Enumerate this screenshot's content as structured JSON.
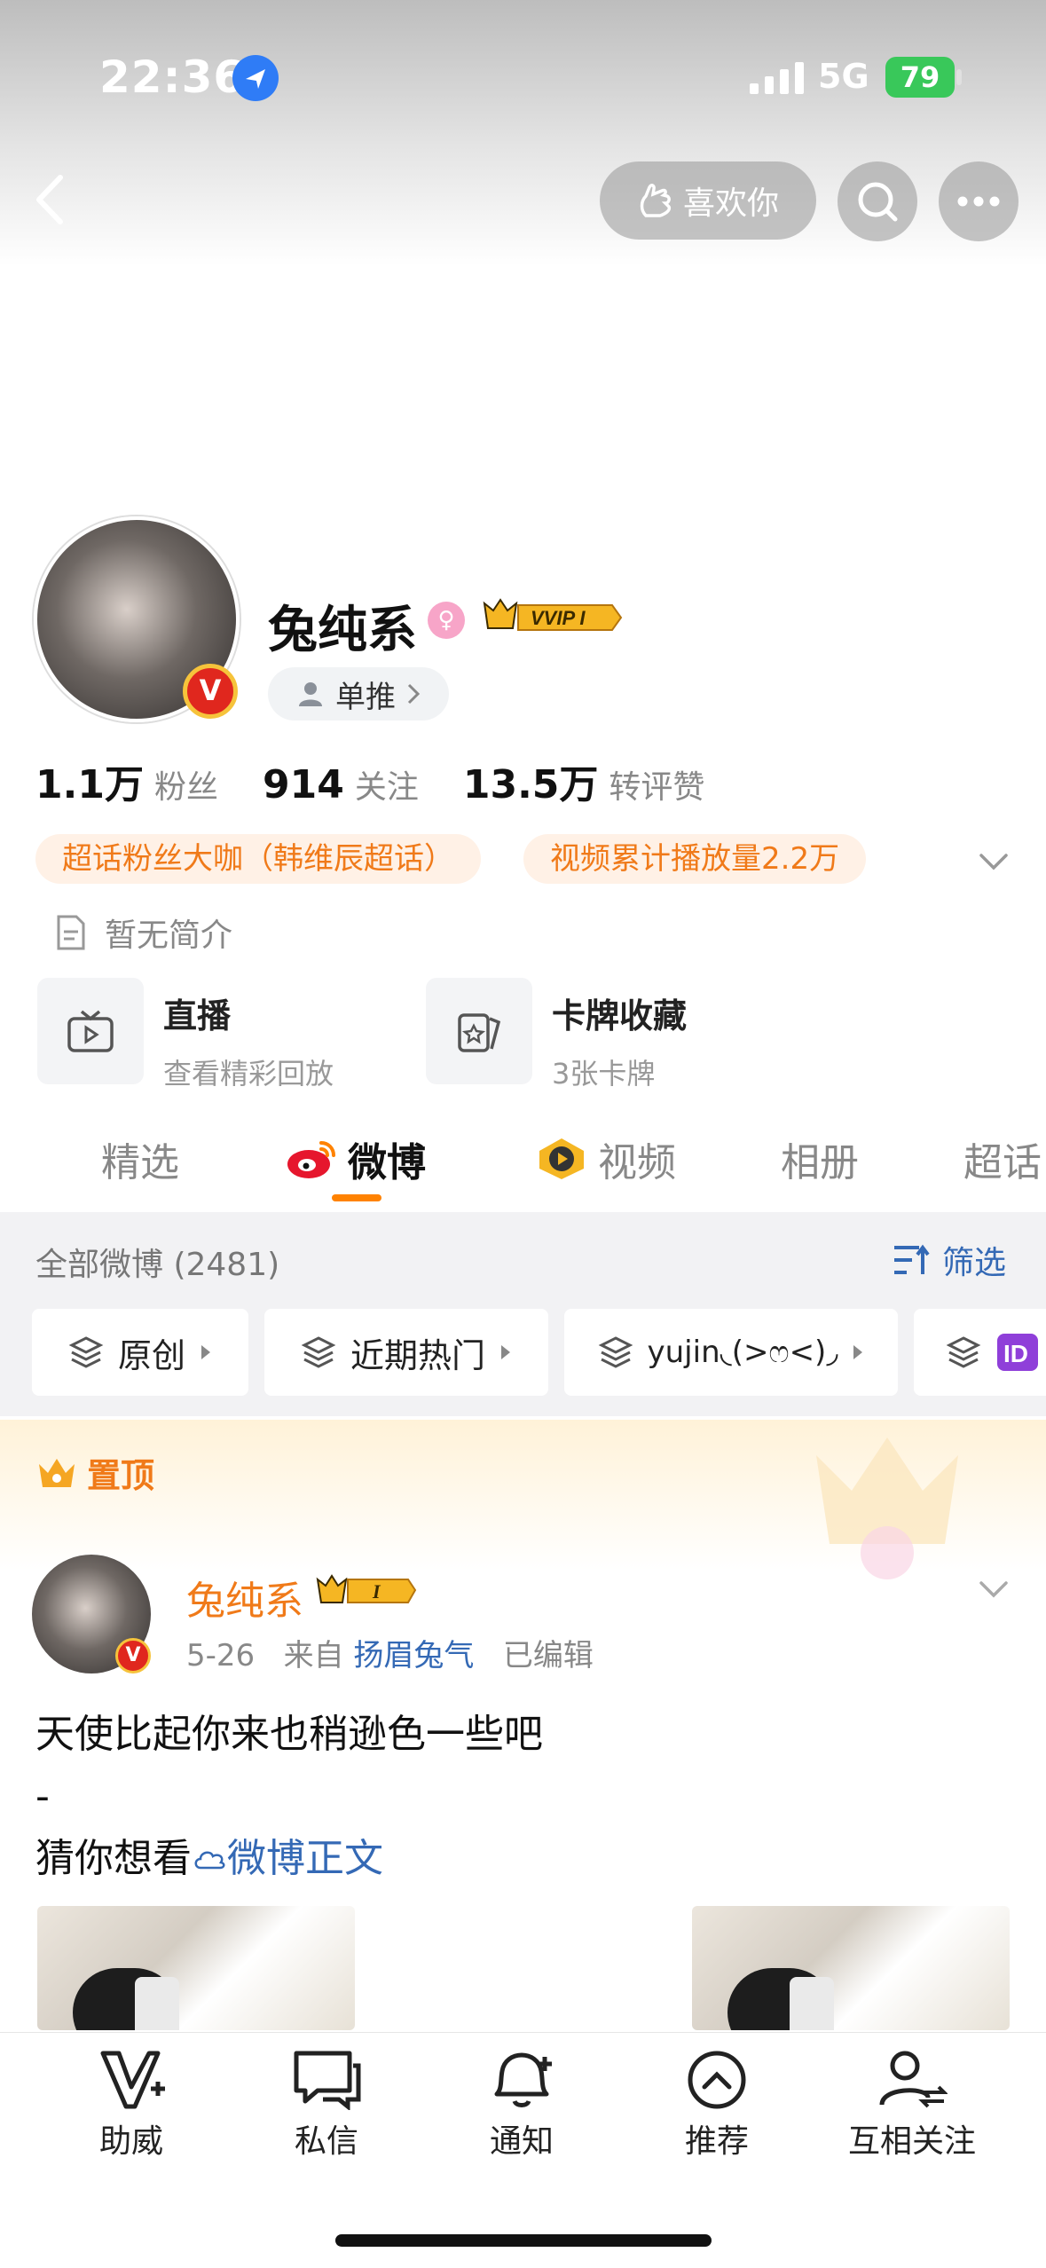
{
  "status_bar": {
    "time": "22:36",
    "network": "5G",
    "battery": "79"
  },
  "nav": {
    "like_label": "喜欢你"
  },
  "profile": {
    "name": "兔纯系",
    "vvip_label": "VVIP I",
    "tag_label": "单推",
    "stats": [
      {
        "value": "1.1万",
        "label": "粉丝"
      },
      {
        "value": "914",
        "label": "关注"
      },
      {
        "value": "13.5万",
        "label": "转评赞"
      }
    ],
    "chips": [
      "超话粉丝大咖（韩维辰超话）",
      "视频累计播放量2.2万"
    ],
    "bio": "暂无简介",
    "features": [
      {
        "title": "直播",
        "sub": "查看精彩回放",
        "icon": "tv-icon"
      },
      {
        "title": "卡牌收藏",
        "sub": "3张卡牌",
        "icon": "card-icon"
      }
    ]
  },
  "tabs": [
    {
      "label": "精选",
      "active": false
    },
    {
      "label": "微博",
      "active": true
    },
    {
      "label": "视频",
      "active": false
    },
    {
      "label": "相册",
      "active": false
    },
    {
      "label": "超话",
      "active": false
    }
  ],
  "feed": {
    "all_count": "全部微博 (2481)",
    "filter_label": "筛选",
    "filter_tags": [
      "原创",
      "近期热门",
      "yujin◟(>ෆ<)◞"
    ],
    "pinned_label": "置顶"
  },
  "post": {
    "author": "兔纯系",
    "vip_label": "I",
    "date": "5-26",
    "source_prefix": "来自",
    "source": "扬眉兔气",
    "edited": "已编辑",
    "line1": "天使比起你来也稍逊色一些吧",
    "line2": "-",
    "line3_prefix": "猜你想看",
    "line3_link": "微博正文"
  },
  "bottom_nav": [
    {
      "label": "助威",
      "icon": "cheer-icon"
    },
    {
      "label": "私信",
      "icon": "message-icon"
    },
    {
      "label": "通知",
      "icon": "bell-icon"
    },
    {
      "label": "推荐",
      "icon": "recommend-icon"
    },
    {
      "label": "互相关注",
      "icon": "follow-icon"
    }
  ],
  "colors": {
    "accent": "#ff8200",
    "link": "#3469b5",
    "chip_text": "#f07a19"
  }
}
